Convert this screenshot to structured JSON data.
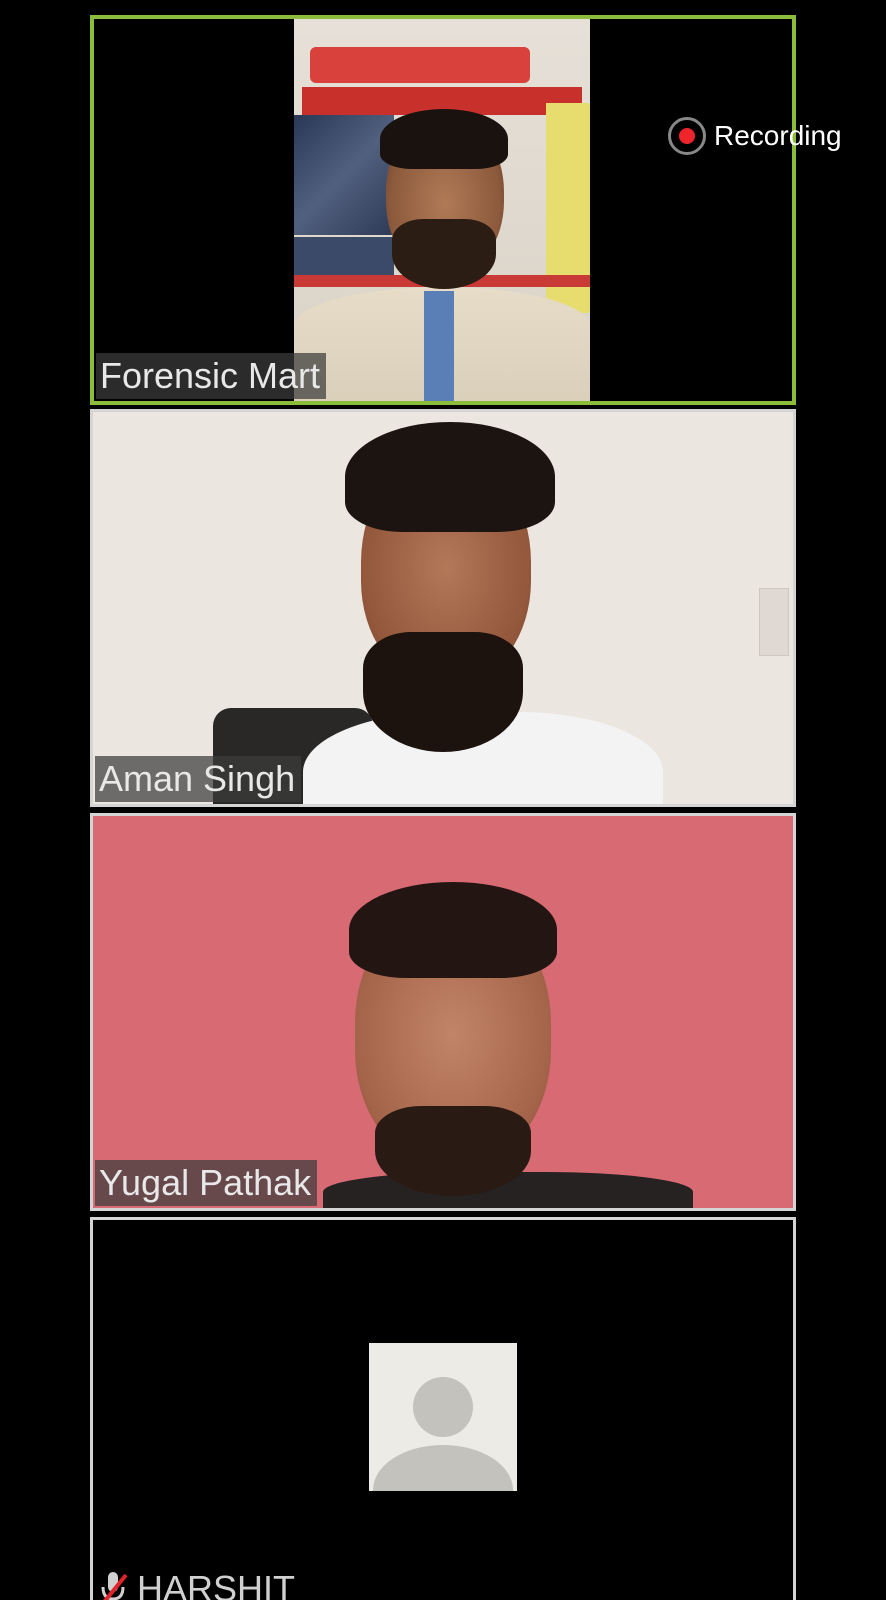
{
  "recording": {
    "label": "Recording"
  },
  "colors": {
    "active_border": "#8cbd3a",
    "tile_border": "#d4d4d4",
    "recording_dot": "#f0242b",
    "muted_slash": "#e0242b"
  },
  "participants": [
    {
      "name": "Forensic Mart",
      "active_speaker": true,
      "video": "on"
    },
    {
      "name": "Aman Singh",
      "active_speaker": false,
      "video": "on"
    },
    {
      "name": "Yugal Pathak",
      "active_speaker": false,
      "video": "on"
    },
    {
      "name": "HARSHIT",
      "active_speaker": false,
      "video": "off",
      "muted": true,
      "avatar_icon": "default-user-avatar-icon"
    }
  ]
}
